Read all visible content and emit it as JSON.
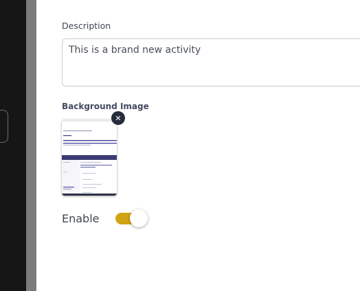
{
  "form": {
    "description_label": "Description",
    "description_value": "This is a brand new activity",
    "background_image_label": "Background Image",
    "remove_glyph": "✕",
    "enable_label": "Enable",
    "enable_on": true
  },
  "colors": {
    "toggle_on": "#d3a317",
    "remove_button": "#262c3a",
    "sidebar_dark": "#161616"
  }
}
